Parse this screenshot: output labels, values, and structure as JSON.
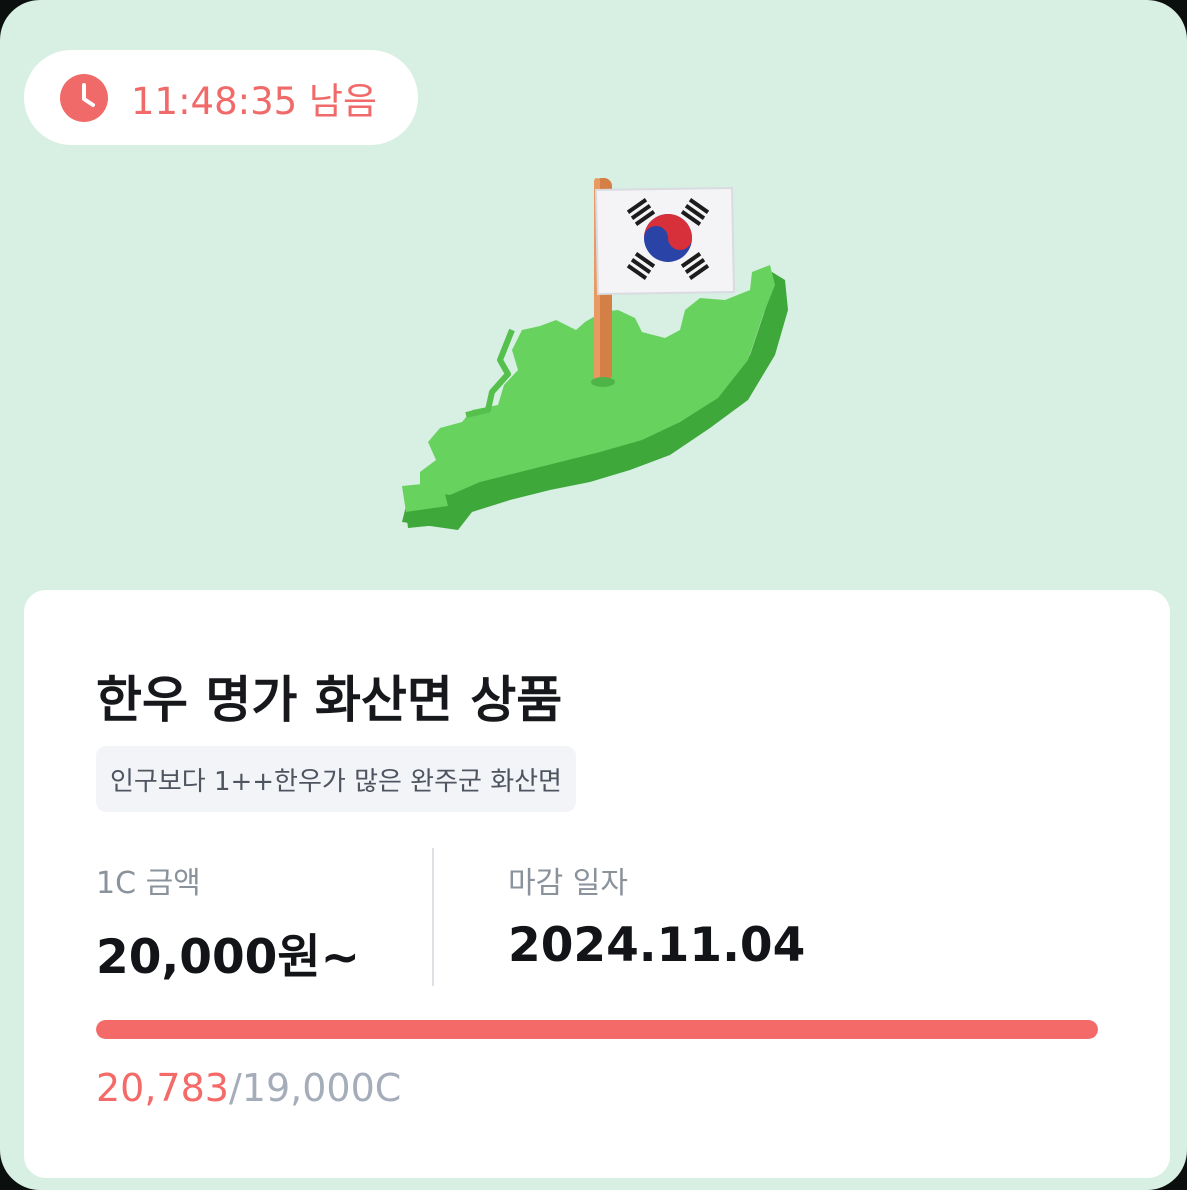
{
  "timer": {
    "text": "11:48:35 남음",
    "icon": "clock-icon",
    "color": "#f06a69"
  },
  "product": {
    "title": "한우 명가 화산면 상품",
    "tag": "인구보다 1++한우가 많은 완주군 화산면",
    "illustration": "korea-map-with-flag"
  },
  "stats": {
    "price_label": "1C 금액",
    "price_value": "20,000원~",
    "deadline_label": "마감 일자",
    "deadline_value": "2024.11.04"
  },
  "progress": {
    "current": "20,783",
    "separator": "/",
    "goal": "19,000C",
    "fill_fraction": 1.0,
    "color": "#f46a68"
  },
  "colors": {
    "background": "#d8efe4",
    "accent": "#f46a68",
    "map_green": "#5fcf58"
  }
}
